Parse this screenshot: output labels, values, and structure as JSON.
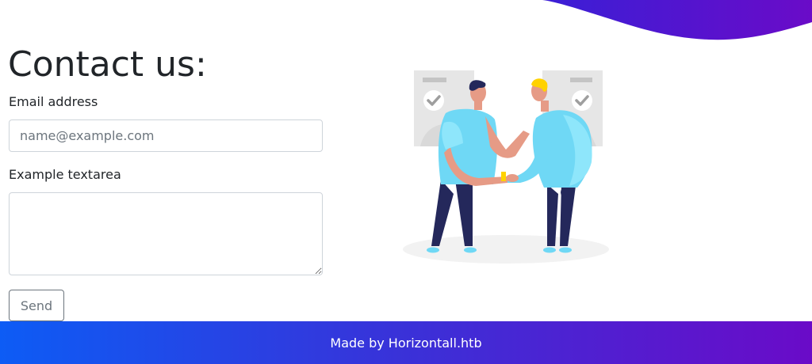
{
  "contact": {
    "title": "Contact us:",
    "email_label": "Email address",
    "email_placeholder": "name@example.com",
    "email_value": "",
    "textarea_label": "Example textarea",
    "textarea_value": "",
    "send_label": "Send"
  },
  "footer": {
    "text": "Made by Horizontall.htb"
  },
  "colors": {
    "gradient_start": "#0d5cf5",
    "gradient_end": "#6a0bc8",
    "shirt": "#6fd8f5",
    "pants": "#24285b"
  },
  "icons": {
    "illustration": "handshake-illustration"
  }
}
